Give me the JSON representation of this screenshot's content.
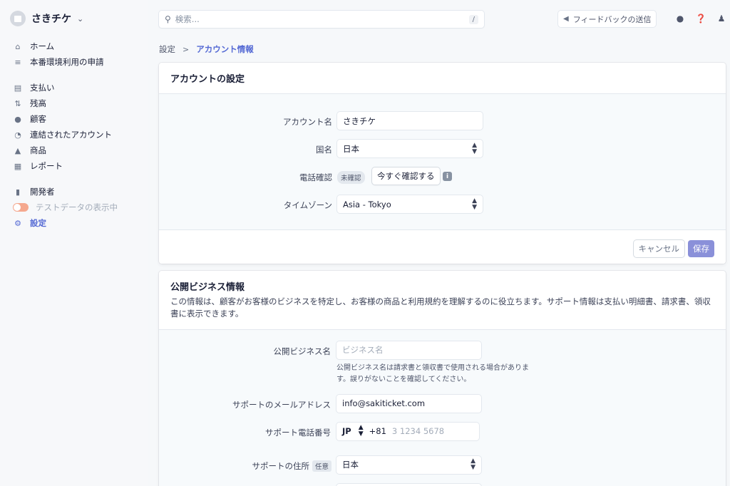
{
  "sidebar": {
    "account_name": "さきチケ",
    "items": [
      {
        "label": "ホーム",
        "icon": "home-icon"
      },
      {
        "label": "本番環境利用の申請",
        "icon": "checklist-icon"
      },
      {
        "label": "支払い",
        "icon": "payments-icon"
      },
      {
        "label": "残高",
        "icon": "balance-icon"
      },
      {
        "label": "顧客",
        "icon": "customer-icon"
      },
      {
        "label": "連結されたアカウント",
        "icon": "connect-icon"
      },
      {
        "label": "商品",
        "icon": "product-icon"
      },
      {
        "label": "レポート",
        "icon": "report-icon"
      },
      {
        "label": "開発者",
        "icon": "terminal-icon"
      },
      {
        "label": "テストデータの表示中",
        "icon": "toggle-icon"
      },
      {
        "label": "設定",
        "icon": "gear-icon"
      }
    ]
  },
  "topbar": {
    "search_placeholder": "検索...",
    "search_shortcut": "/",
    "feedback_label": "フィードバックの送信"
  },
  "breadcrumb": {
    "parent": "設定",
    "separator": ">",
    "current": "アカウント情報"
  },
  "account_settings": {
    "title": "アカウントの設定",
    "account_name_label": "アカウント名",
    "account_name_value": "さきチケ",
    "country_label": "国名",
    "country_value": "日本",
    "phone_verify_label": "電話確認",
    "phone_verify_badge": "未確認",
    "phone_verify_button": "今すぐ確認する",
    "timezone_label": "タイムゾーン",
    "timezone_value": "Asia - Tokyo",
    "cancel_label": "キャンセル",
    "save_label": "保存"
  },
  "public_info": {
    "title": "公開ビジネス情報",
    "description": "この情報は、顧客がお客様のビジネスを特定し、お客様の商品と利用規約を理解するのに役立ちます。サポート情報は支払い明細書、請求書、領収書に表示できます。",
    "business_name_label": "公開ビジネス名",
    "business_name_placeholder": "ビジネス名",
    "business_name_help": "公開ビジネス名は請求書と領収書で使用される場合があります。誤りがないことを確認してください。",
    "support_email_label": "サポートのメールアドレス",
    "support_email_value": "info@sakiticket.com",
    "support_phone_label": "サポート電話番号",
    "support_phone_country": "JP",
    "support_phone_code": "+81",
    "support_phone_placeholder": "3 1234 5678",
    "support_address_label": "サポートの住所",
    "support_address_optional": "任意",
    "support_address_country": "日本"
  },
  "colors": {
    "accent": "#5469d4",
    "save_button": "#8a90d9",
    "toggle": "#f5a88e"
  }
}
